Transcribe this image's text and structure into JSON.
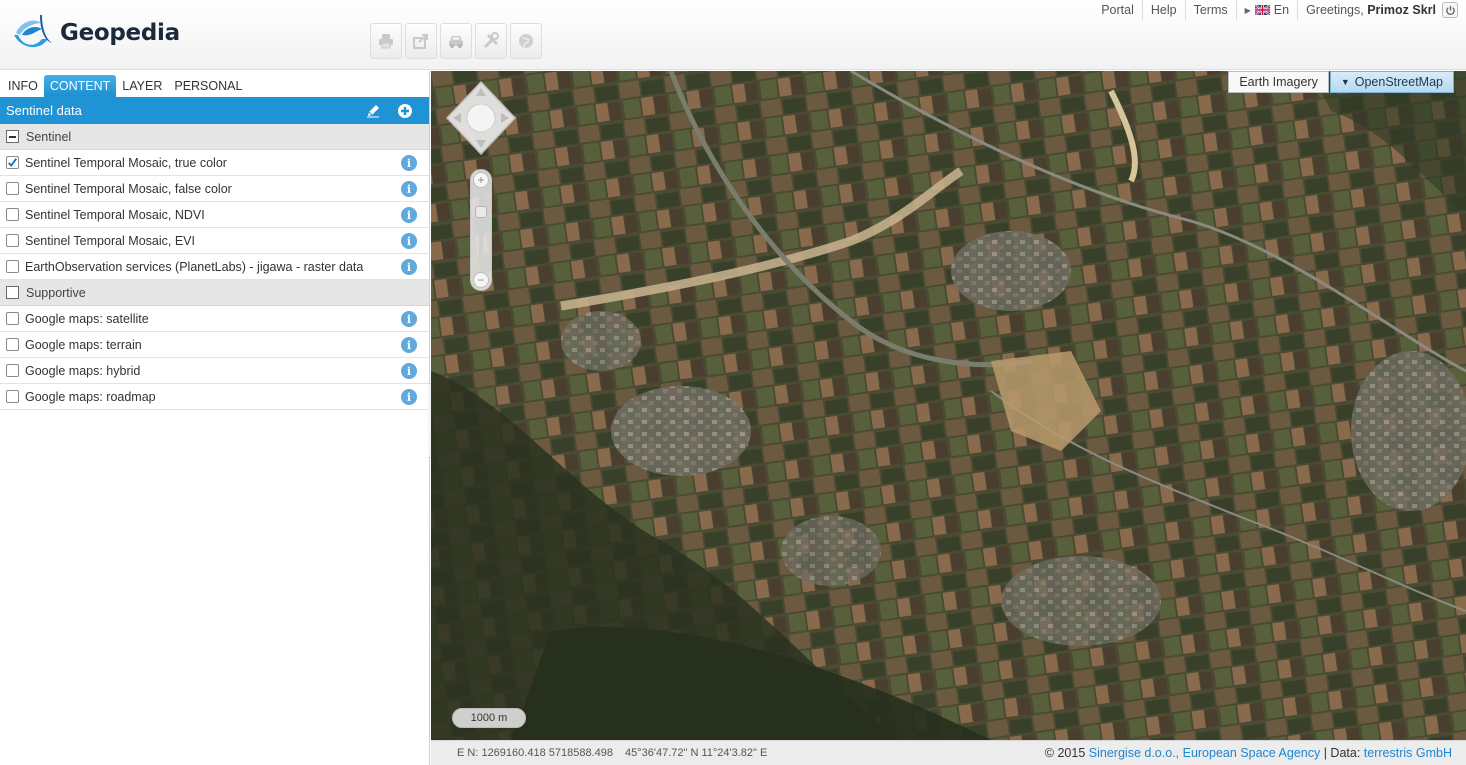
{
  "app": {
    "name": "Geopedia"
  },
  "toolbar": {
    "buttons": [
      {
        "name": "print-button",
        "icon": "printer-icon"
      },
      {
        "name": "share-button",
        "icon": "share-icon"
      },
      {
        "name": "route-button",
        "icon": "car-icon"
      },
      {
        "name": "tools-button",
        "icon": "tools-icon"
      },
      {
        "name": "globe-button",
        "icon": "globe-icon"
      }
    ]
  },
  "topnav": {
    "portal": "Portal",
    "help": "Help",
    "terms": "Terms",
    "language": "En",
    "greeting_prefix": "Greetings,",
    "user": "Primoz Skrl"
  },
  "panel": {
    "tabs": [
      "INFO",
      "CONTENT",
      "LAYER",
      "PERSONAL"
    ],
    "active_tab": "CONTENT",
    "group_title": "Sentinel data",
    "sections": [
      {
        "title": "Sentinel",
        "expanded": true,
        "layers": [
          {
            "label": "Sentinel Temporal Mosaic, true color",
            "checked": true
          },
          {
            "label": "Sentinel Temporal Mosaic, false color",
            "checked": false
          },
          {
            "label": "Sentinel Temporal Mosaic, NDVI",
            "checked": false
          },
          {
            "label": "Sentinel Temporal Mosaic, EVI",
            "checked": false
          },
          {
            "label": "EarthObservation services (PlanetLabs) - jigawa - raster data",
            "checked": false
          }
        ]
      },
      {
        "title": "Supportive",
        "expanded": false,
        "layers": [
          {
            "label": "Google maps: satellite",
            "checked": false
          },
          {
            "label": "Google maps: terrain",
            "checked": false
          },
          {
            "label": "Google maps: hybrid",
            "checked": false
          },
          {
            "label": "Google maps: roadmap",
            "checked": false
          }
        ]
      }
    ]
  },
  "map": {
    "basemap_options": [
      "Earth Imagery",
      "OpenStreetMap"
    ],
    "active_basemap": "OpenStreetMap",
    "scale_label": "1000 m"
  },
  "status": {
    "coords_en": "E N: 1269160.418 5718588.498",
    "coords_latlon": "45°36'47.72\" N 11°24'3.82\" E",
    "copyright": "© 2015",
    "credit_1": "Sinergise d.o.o.,",
    "credit_2": "European Space Agency",
    "data_label": "| Data:",
    "credit_3": "terrestris GmbH"
  },
  "colors": {
    "accent": "#1f93d3",
    "link": "#1e86cf",
    "info_icon": "#5fa9dc"
  }
}
